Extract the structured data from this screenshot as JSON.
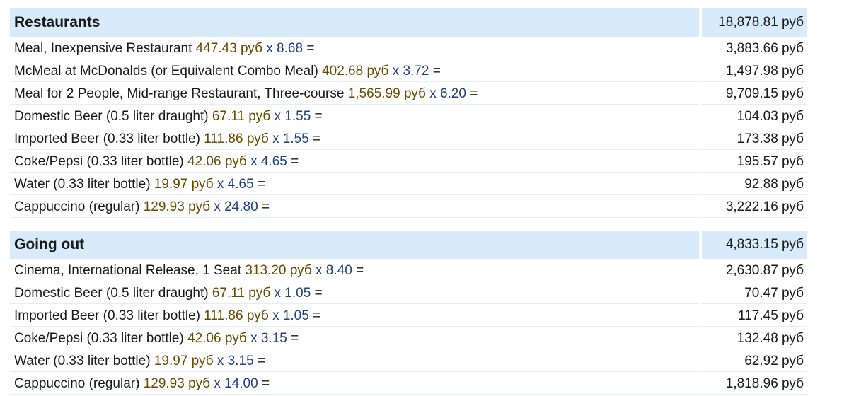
{
  "sections": [
    {
      "name": "Restaurants",
      "total": "18,878.81 руб",
      "items": [
        {
          "label": "Meal, Inexpensive Restaurant",
          "price": "447.43 руб",
          "mult": "x 8.68",
          "total": "3,883.66 руб"
        },
        {
          "label": "McMeal at McDonalds (or Equivalent Combo Meal)",
          "price": "402.68 руб",
          "mult": "x 3.72",
          "total": "1,497.98 руб"
        },
        {
          "label": "Meal for 2 People, Mid-range Restaurant, Three-course",
          "price": "1,565.99 руб",
          "mult": "x 6.20",
          "total": "9,709.15 руб"
        },
        {
          "label": "Domestic Beer (0.5 liter draught)",
          "price": "67.11 руб",
          "mult": "x 1.55",
          "total": "104.03 руб"
        },
        {
          "label": "Imported Beer (0.33 liter bottle)",
          "price": "111.86 руб",
          "mult": "x 1.55",
          "total": "173.38 руб"
        },
        {
          "label": "Coke/Pepsi (0.33 liter bottle)",
          "price": "42.06 руб",
          "mult": "x 4.65",
          "total": "195.57 руб"
        },
        {
          "label": "Water (0.33 liter bottle)",
          "price": "19.97 руб",
          "mult": "x 4.65",
          "total": "92.88 руб"
        },
        {
          "label": "Cappuccino (regular)",
          "price": "129.93 руб",
          "mult": "x 24.80",
          "total": "3,222.16 руб"
        }
      ]
    },
    {
      "name": "Going out",
      "total": "4,833.15 руб",
      "items": [
        {
          "label": "Cinema, International Release, 1 Seat",
          "price": "313.20 руб",
          "mult": "x 8.40",
          "total": "2,630.87 руб"
        },
        {
          "label": "Domestic Beer (0.5 liter draught)",
          "price": "67.11 руб",
          "mult": "x 1.05",
          "total": "70.47 руб"
        },
        {
          "label": "Imported Beer (0.33 liter bottle)",
          "price": "111.86 руб",
          "mult": "x 1.05",
          "total": "117.45 руб"
        },
        {
          "label": "Coke/Pepsi (0.33 liter bottle)",
          "price": "42.06 руб",
          "mult": "x 3.15",
          "total": "132.48 руб"
        },
        {
          "label": "Water (0.33 liter bottle)",
          "price": "19.97 руб",
          "mult": "x 3.15",
          "total": "62.92 руб"
        },
        {
          "label": "Cappuccino (regular)",
          "price": "129.93 руб",
          "mult": "x 14.00",
          "total": "1,818.96 руб"
        }
      ]
    }
  ],
  "equals_sign": "=",
  "colors": {
    "category_bg": "#d7ebfb",
    "price_text": "#6a4a00",
    "multiplier_text": "#1f3f86"
  }
}
